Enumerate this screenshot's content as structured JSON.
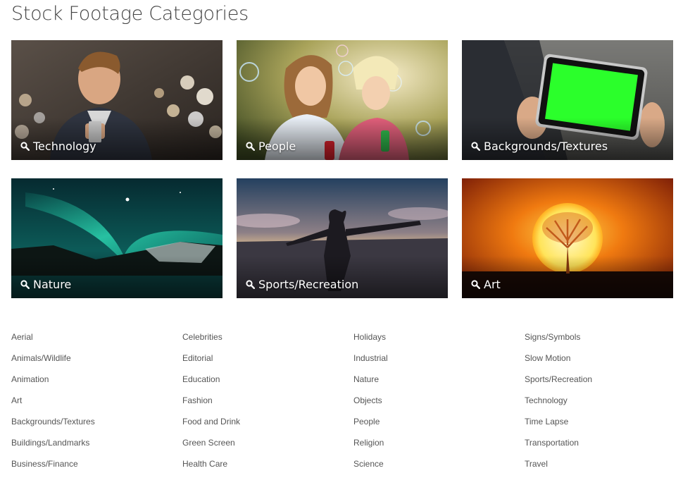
{
  "page": {
    "title": "Stock Footage Categories"
  },
  "featured": [
    {
      "label": "Technology"
    },
    {
      "label": "People"
    },
    {
      "label": "Backgrounds/Textures"
    },
    {
      "label": "Nature"
    },
    {
      "label": "Sports/Recreation"
    },
    {
      "label": "Art"
    }
  ],
  "categories": {
    "col1": [
      "Aerial",
      "Animals/Wildlife",
      "Animation",
      "Art",
      "Backgrounds/Textures",
      "Buildings/Landmarks",
      "Business/Finance"
    ],
    "col2": [
      "Celebrities",
      "Editorial",
      "Education",
      "Fashion",
      "Food and Drink",
      "Green Screen",
      "Health Care"
    ],
    "col3": [
      "Holidays",
      "Industrial",
      "Nature",
      "Objects",
      "People",
      "Religion",
      "Science"
    ],
    "col4": [
      "Signs/Symbols",
      "Slow Motion",
      "Sports/Recreation",
      "Technology",
      "Time Lapse",
      "Transportation",
      "Travel"
    ]
  },
  "icons": {
    "tile_label_icon": "search-icon"
  },
  "colors": {
    "title": "#444444",
    "link": "#555555",
    "tile_text": "#ffffff",
    "green_screen": "#2bff2b"
  }
}
